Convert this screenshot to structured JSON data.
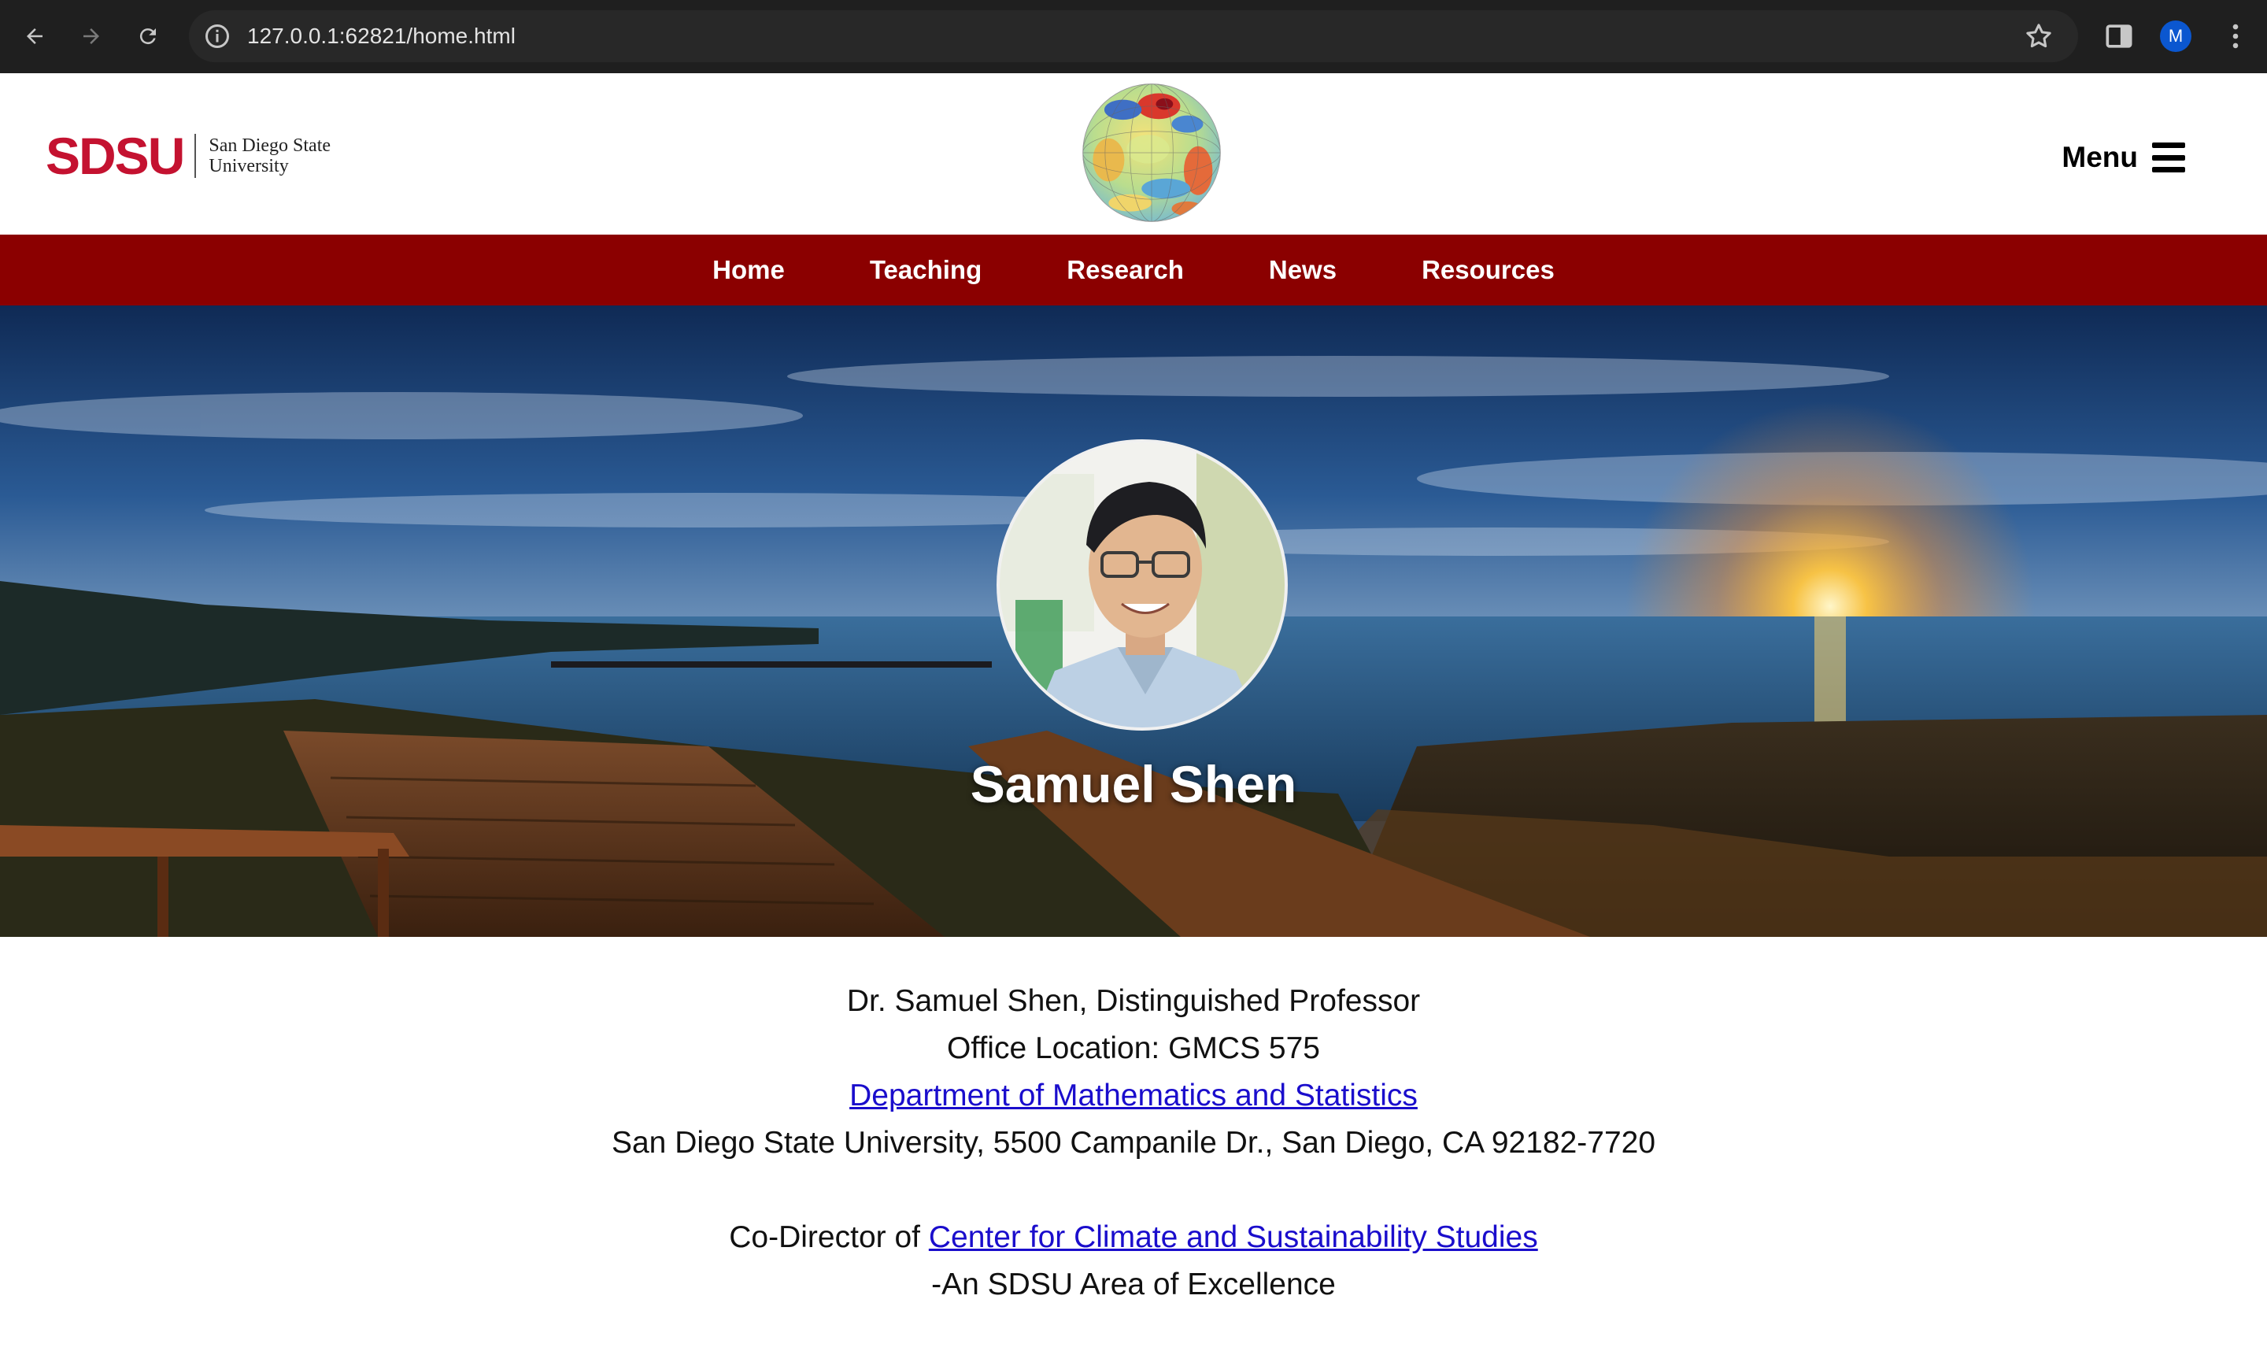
{
  "browser": {
    "url": "127.0.0.1:62821/home.html",
    "profile_initial": "M"
  },
  "header": {
    "logo_word": "SDSU",
    "logo_line1": "San Diego State",
    "logo_line2": "University",
    "menu_label": "Menu"
  },
  "nav": {
    "items": [
      {
        "label": "Home"
      },
      {
        "label": "Teaching"
      },
      {
        "label": "Research"
      },
      {
        "label": "News"
      },
      {
        "label": "Resources"
      }
    ]
  },
  "hero": {
    "name": "Samuel Shen"
  },
  "content": {
    "line1": "Dr. Samuel Shen, Distinguished Professor",
    "line2": "Office Location: GMCS 575",
    "dept_link": "Department of Mathematics and Statistics",
    "address": "San Diego State University, 5500 Campanile Dr., San Diego, CA 92182-7720",
    "codirector_prefix": "Co-Director of",
    "center_link": "Center for Climate and Sustainability Studies",
    "excellence": "-An SDSU Area of Excellence"
  },
  "colors": {
    "brand_red": "#c41230",
    "nav_bg": "#8b0000",
    "link": "#1a0dcc"
  }
}
